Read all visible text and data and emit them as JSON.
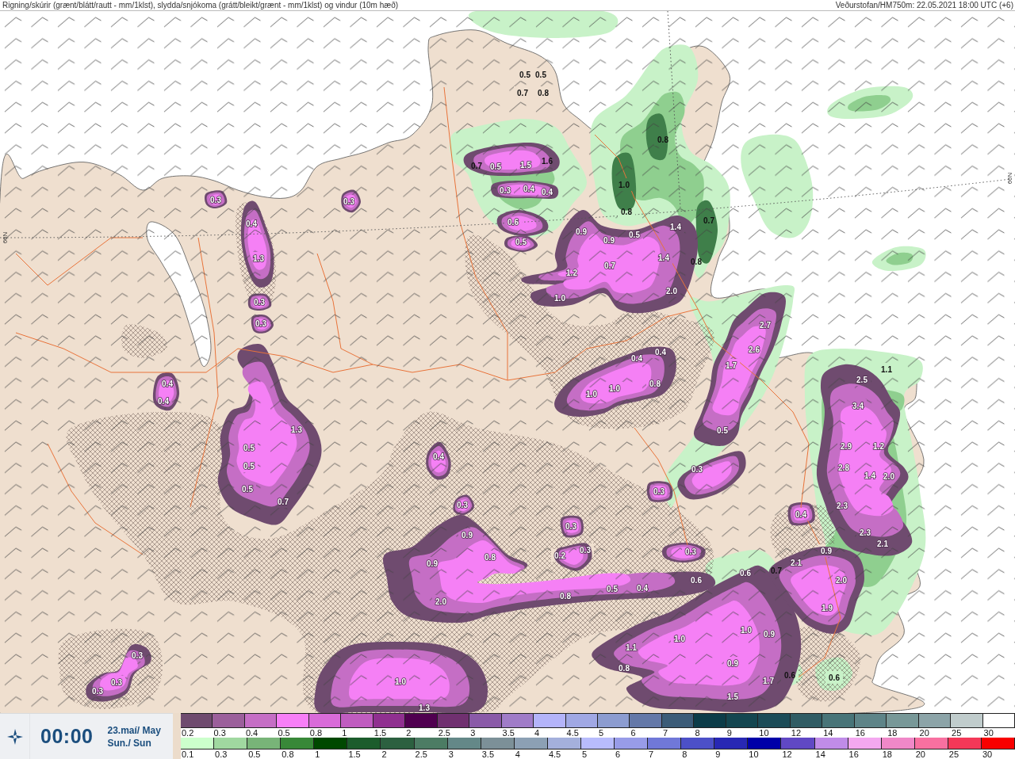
{
  "header": {
    "title": "Rigning/skúrir (grænt/blátt/rautt - mm/1klst), slydda/snjókoma (grátt/bleikt/grænt - mm/1klst) og vindur (10m hæð)",
    "source": "Veðurstofan/HM750m: 22.05.2021 18:00 UTC (+6)"
  },
  "map": {
    "latitude_labels": [
      "66N",
      "66N"
    ],
    "value_labels": [
      "0.5",
      "0.5",
      "0.7",
      "0.8",
      "0.8",
      "0.7",
      "0.5",
      "1.5",
      "1.6",
      "0.3",
      "0.4",
      "0.4",
      "1.0",
      "0.8",
      "0.7",
      "0.3",
      "0.3",
      "0.4",
      "0.6",
      "0.5",
      "0.9",
      "0.9",
      "0.5",
      "1.4",
      "1.4",
      "0.8",
      "1.3",
      "1.2",
      "0.7",
      "1.0",
      "2.0",
      "0.3",
      "0.3",
      "2.7",
      "2.6",
      "1.7",
      "0.4",
      "0.4",
      "1.0",
      "1.0",
      "0.8",
      "0.4",
      "0.4",
      "1.3",
      "1.1",
      "2.5",
      "3.4",
      "2.9",
      "1.2",
      "2.8",
      "1.4",
      "2.0",
      "2.3",
      "2.3",
      "2.1",
      "0.5",
      "0.5",
      "0.5",
      "0.5",
      "0.7",
      "0.4",
      "0.3",
      "0.3",
      "0.3",
      "0.4",
      "0.3",
      "0.9",
      "0.8",
      "0.3",
      "0.2",
      "0.3",
      "0.9",
      "0.9",
      "2.1",
      "0.7",
      "0.6",
      "2.0",
      "0.5",
      "0.4",
      "0.6",
      "2.0",
      "0.8",
      "1.9",
      "1.0",
      "0.9",
      "1.0",
      "1.1",
      "0.9",
      "0.8",
      "1.7",
      "0.6",
      "0.3",
      "0.3",
      "0.3",
      "1.0",
      "1.3",
      "1.5",
      "0.6"
    ]
  },
  "time_panel": {
    "time": "00:00",
    "date": "23.maí/ May",
    "weekday": "Sun./ Sun"
  },
  "legend": {
    "scales": [
      {
        "steps": [
          {
            "label": "0.2",
            "color": "#6f4b6f"
          },
          {
            "label": "0.3",
            "color": "#9b5f9b"
          },
          {
            "label": "0.4",
            "color": "#c56ec5"
          },
          {
            "label": "0.5",
            "color": "#f77ff7"
          },
          {
            "label": "0.8",
            "color": "#d96bd9"
          },
          {
            "label": "1",
            "color": "#c05cc0"
          },
          {
            "label": "1.5",
            "color": "#903090"
          },
          {
            "label": "2",
            "color": "#500050"
          },
          {
            "label": "2.5",
            "color": "#703070"
          },
          {
            "label": "3",
            "color": "#8a5aa8"
          },
          {
            "label": "3.5",
            "color": "#a07cc8"
          },
          {
            "label": "4",
            "color": "#b4b4fa"
          },
          {
            "label": "4.5",
            "color": "#a0a8e4"
          },
          {
            "label": "5",
            "color": "#8c9cd0"
          },
          {
            "label": "6",
            "color": "#6478a8"
          },
          {
            "label": "7",
            "color": "#3c5c78"
          },
          {
            "label": "8",
            "color": "#0c3c48"
          },
          {
            "label": "9",
            "color": "#144650"
          },
          {
            "label": "10",
            "color": "#1c4c58"
          },
          {
            "label": "12",
            "color": "#305c64"
          },
          {
            "label": "14",
            "color": "#487478"
          },
          {
            "label": "16",
            "color": "#5e8488"
          },
          {
            "label": "18",
            "color": "#789898"
          },
          {
            "label": "20",
            "color": "#8ca4a8"
          },
          {
            "label": "25",
            "color": "#c0cccc"
          },
          {
            "label": "30",
            "color": "#ffffff"
          }
        ]
      },
      {
        "steps": [
          {
            "label": "0.1",
            "color": "#ccffcc"
          },
          {
            "label": "0.3",
            "color": "#a0d8a0"
          },
          {
            "label": "0.5",
            "color": "#78b478"
          },
          {
            "label": "0.8",
            "color": "#388838"
          },
          {
            "label": "1",
            "color": "#004800"
          },
          {
            "label": "1.5",
            "color": "#1c5c2c"
          },
          {
            "label": "2",
            "color": "#2c6040"
          },
          {
            "label": "2.5",
            "color": "#4c7c64"
          },
          {
            "label": "3",
            "color": "#648888"
          },
          {
            "label": "3.5",
            "color": "#7c9098"
          },
          {
            "label": "4",
            "color": "#8ca0b4"
          },
          {
            "label": "4.5",
            "color": "#a4b0dc"
          },
          {
            "label": "5",
            "color": "#b8bcfc"
          },
          {
            "label": "6",
            "color": "#989ce8"
          },
          {
            "label": "7",
            "color": "#7078d8"
          },
          {
            "label": "8",
            "color": "#4c50c8"
          },
          {
            "label": "9",
            "color": "#2828b4"
          },
          {
            "label": "10",
            "color": "#0000a8"
          },
          {
            "label": "12",
            "color": "#6048c4"
          },
          {
            "label": "14",
            "color": "#c08ce8"
          },
          {
            "label": "16",
            "color": "#f4a8f0"
          },
          {
            "label": "18",
            "color": "#f088c8"
          },
          {
            "label": "20",
            "color": "#f870a0"
          },
          {
            "label": "25",
            "color": "#f43858"
          },
          {
            "label": "30",
            "color": "#f80000"
          }
        ]
      }
    ]
  }
}
